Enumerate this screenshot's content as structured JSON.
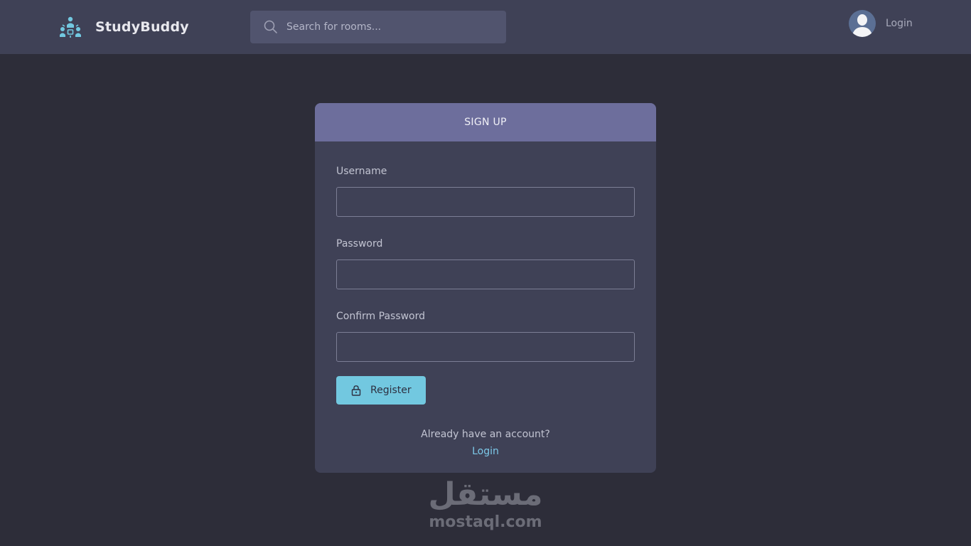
{
  "brand": {
    "name": "StudyBuddy",
    "icon": "study-group-logo-icon"
  },
  "search": {
    "placeholder": "Search for rooms...",
    "value": "",
    "icon": "search-icon"
  },
  "user": {
    "login_label": "Login",
    "icon": "avatar-icon"
  },
  "signup": {
    "title": "SIGN UP",
    "fields": [
      {
        "label": "Username",
        "value": ""
      },
      {
        "label": "Password",
        "value": ""
      },
      {
        "label": "Confirm Password",
        "value": ""
      }
    ],
    "register_label": "Register",
    "register_icon": "lock-icon",
    "footer_text": "Already have an account?",
    "footer_link": "Login"
  },
  "watermark": {
    "arabic": "مستقل",
    "latin": "mostaql.com"
  },
  "colors": {
    "background": "#2d2d39",
    "topbar": "#3f4156",
    "card_header": "#6d6e9c",
    "accent": "#72c8e0",
    "link": "#7cc8e8"
  }
}
